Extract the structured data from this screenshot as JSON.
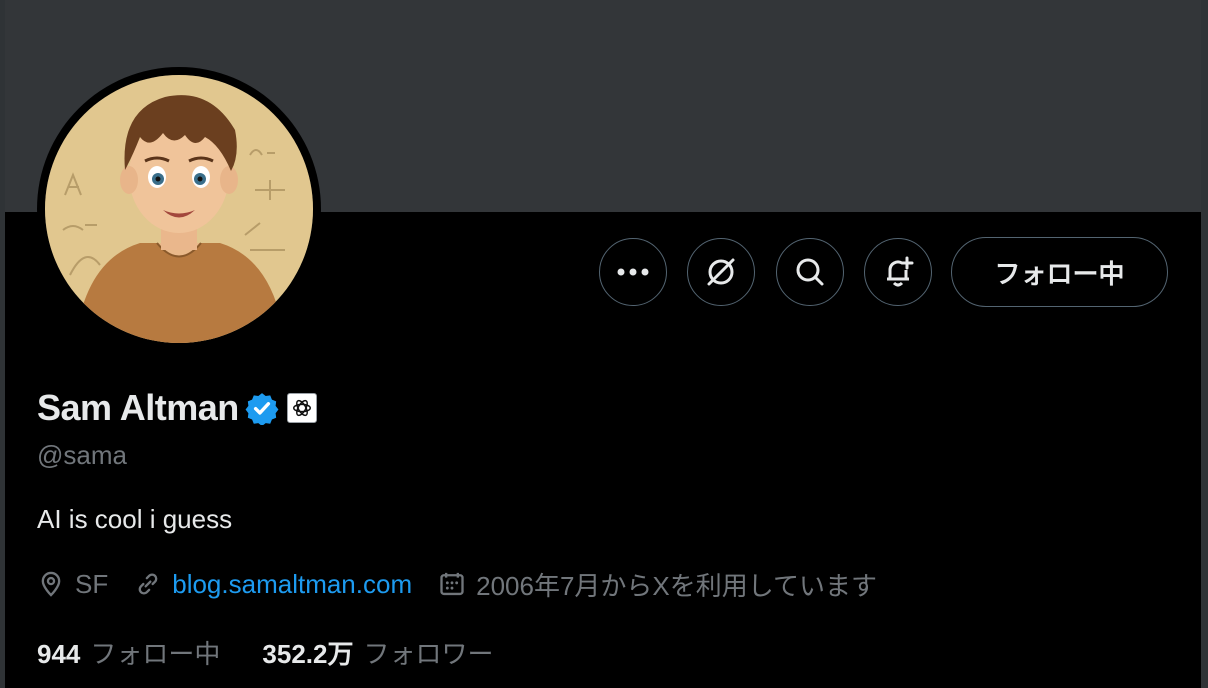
{
  "profile": {
    "name": "Sam Altman",
    "handle": "@sama",
    "bio": "AI is cool i guess",
    "location": "SF",
    "website": "blog.samaltman.com",
    "joined": "2006年7月からXを利用しています"
  },
  "actions": {
    "follow_label": "フォロー中"
  },
  "stats": {
    "following_count": "944",
    "following_label": "フォロー中",
    "followers_count": "352.2万",
    "followers_label": "フォロワー"
  },
  "icons": {
    "more": "more-dots-icon",
    "grok": "grok-icon",
    "search": "search-icon",
    "notify": "bell-plus-icon",
    "verified": "verified-badge-icon",
    "affiliation": "openai-logo-icon",
    "location": "location-pin-icon",
    "link": "link-icon",
    "calendar": "calendar-icon"
  },
  "colors": {
    "background": "#000000",
    "banner": "#333639",
    "accent": "#1d9bf0",
    "secondary_text": "#71767b",
    "primary_text": "#e7e9ea"
  }
}
